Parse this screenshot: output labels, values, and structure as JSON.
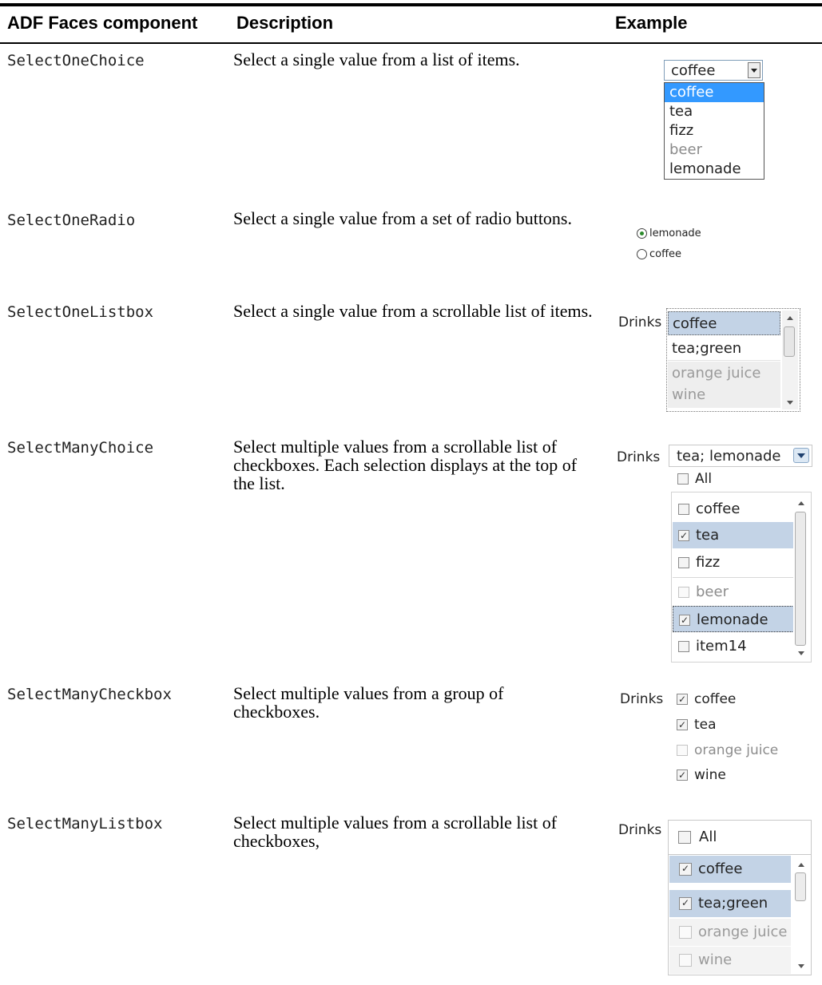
{
  "table": {
    "headers": [
      "ADF Faces component",
      "Description",
      "Example"
    ],
    "rows": [
      {
        "component": "SelectOneChoice",
        "description": "Select a single value from a list of items."
      },
      {
        "component": "SelectOneRadio",
        "description": "Select a single value from a set of radio buttons."
      },
      {
        "component": "SelectOneListbox",
        "description": "Select a single value from a scrollable list of items."
      },
      {
        "component": "SelectManyChoice",
        "description": "Select multiple values from a scrollable list of checkboxes. Each selection displays at the top of the list."
      },
      {
        "component": "SelectManyCheckbox",
        "description": "Select multiple values from a group of checkboxes."
      },
      {
        "component": "SelectManyListbox",
        "description": "Select multiple values from a scrollable list of checkboxes,"
      }
    ]
  },
  "examples": {
    "one_choice": {
      "value": "coffee",
      "options": [
        {
          "label": "coffee",
          "state": "selected"
        },
        {
          "label": "tea",
          "state": "normal"
        },
        {
          "label": "fizz",
          "state": "normal"
        },
        {
          "label": "beer",
          "state": "disabled"
        },
        {
          "label": "lemonade",
          "state": "normal"
        }
      ]
    },
    "one_radio": {
      "options": [
        {
          "label": "lemonade",
          "checked": true
        },
        {
          "label": "coffee",
          "checked": false
        }
      ]
    },
    "one_listbox": {
      "label": "Drinks",
      "items": [
        {
          "label": "coffee",
          "state": "selected"
        },
        {
          "label": "tea;green",
          "state": "normal"
        },
        {
          "label": "orange juice",
          "state": "disabled"
        },
        {
          "label": "wine",
          "state": "disabled"
        }
      ]
    },
    "many_choice": {
      "label": "Drinks",
      "value": "tea; lemonade",
      "all_label": "All",
      "items": [
        {
          "label": "coffee",
          "checked": false,
          "state": "normal"
        },
        {
          "label": "tea",
          "checked": true,
          "state": "selected"
        },
        {
          "label": "fizz",
          "checked": false,
          "state": "normal"
        },
        {
          "label": "beer",
          "checked": false,
          "state": "disabled"
        },
        {
          "label": "lemonade",
          "checked": true,
          "state": "focused"
        },
        {
          "label": "item14",
          "checked": false,
          "state": "normal"
        }
      ]
    },
    "many_checkbox": {
      "label": "Drinks",
      "items": [
        {
          "label": "coffee",
          "checked": true,
          "state": "normal"
        },
        {
          "label": "tea",
          "checked": true,
          "state": "normal"
        },
        {
          "label": "orange juice",
          "checked": false,
          "state": "disabled"
        },
        {
          "label": "wine",
          "checked": true,
          "state": "normal"
        }
      ]
    },
    "many_listbox": {
      "label": "Drinks",
      "all_label": "All",
      "items": [
        {
          "label": "coffee",
          "checked": true,
          "state": "selected"
        },
        {
          "label": "tea;green",
          "checked": true,
          "state": "selected"
        },
        {
          "label": "orange juice",
          "checked": false,
          "state": "disabled"
        },
        {
          "label": "wine",
          "checked": false,
          "state": "disabled"
        }
      ]
    }
  },
  "colors": {
    "selection_blue": "#3399ff",
    "selection_light": "#c3d3e6",
    "disabled_text": "#8c8c8c"
  }
}
